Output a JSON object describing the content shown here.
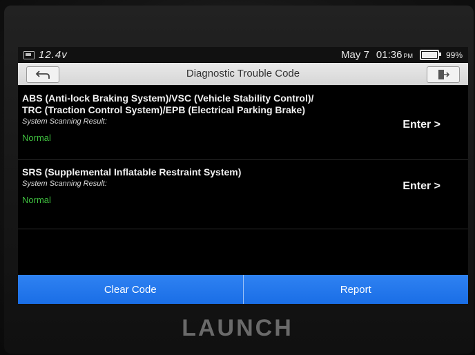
{
  "statusbar": {
    "voltage": "12.4v",
    "date": "May 7",
    "time": "01:36",
    "ampm": "PM",
    "battery_pct": "99%"
  },
  "titlebar": {
    "title": "Diagnostic Trouble Code"
  },
  "systems": [
    {
      "name_line1": "ABS (Anti-lock Braking System)/VSC (Vehicle Stability Control)/",
      "name_line2": "TRC (Traction Control System)/EPB (Electrical Parking Brake)",
      "result_label": "System Scanning Result:",
      "result": "Normal",
      "enter_label": "Enter >"
    },
    {
      "name_line1": "SRS (Supplemental Inflatable Restraint System)",
      "result_label": "System Scanning Result:",
      "result": "Normal",
      "enter_label": "Enter >"
    }
  ],
  "buttons": {
    "clear_code": "Clear Code",
    "report": "Report"
  },
  "brand": "LAUNCH",
  "colors": {
    "accent_blue": "#1a6ee6",
    "status_normal": "#3fbf3f"
  }
}
